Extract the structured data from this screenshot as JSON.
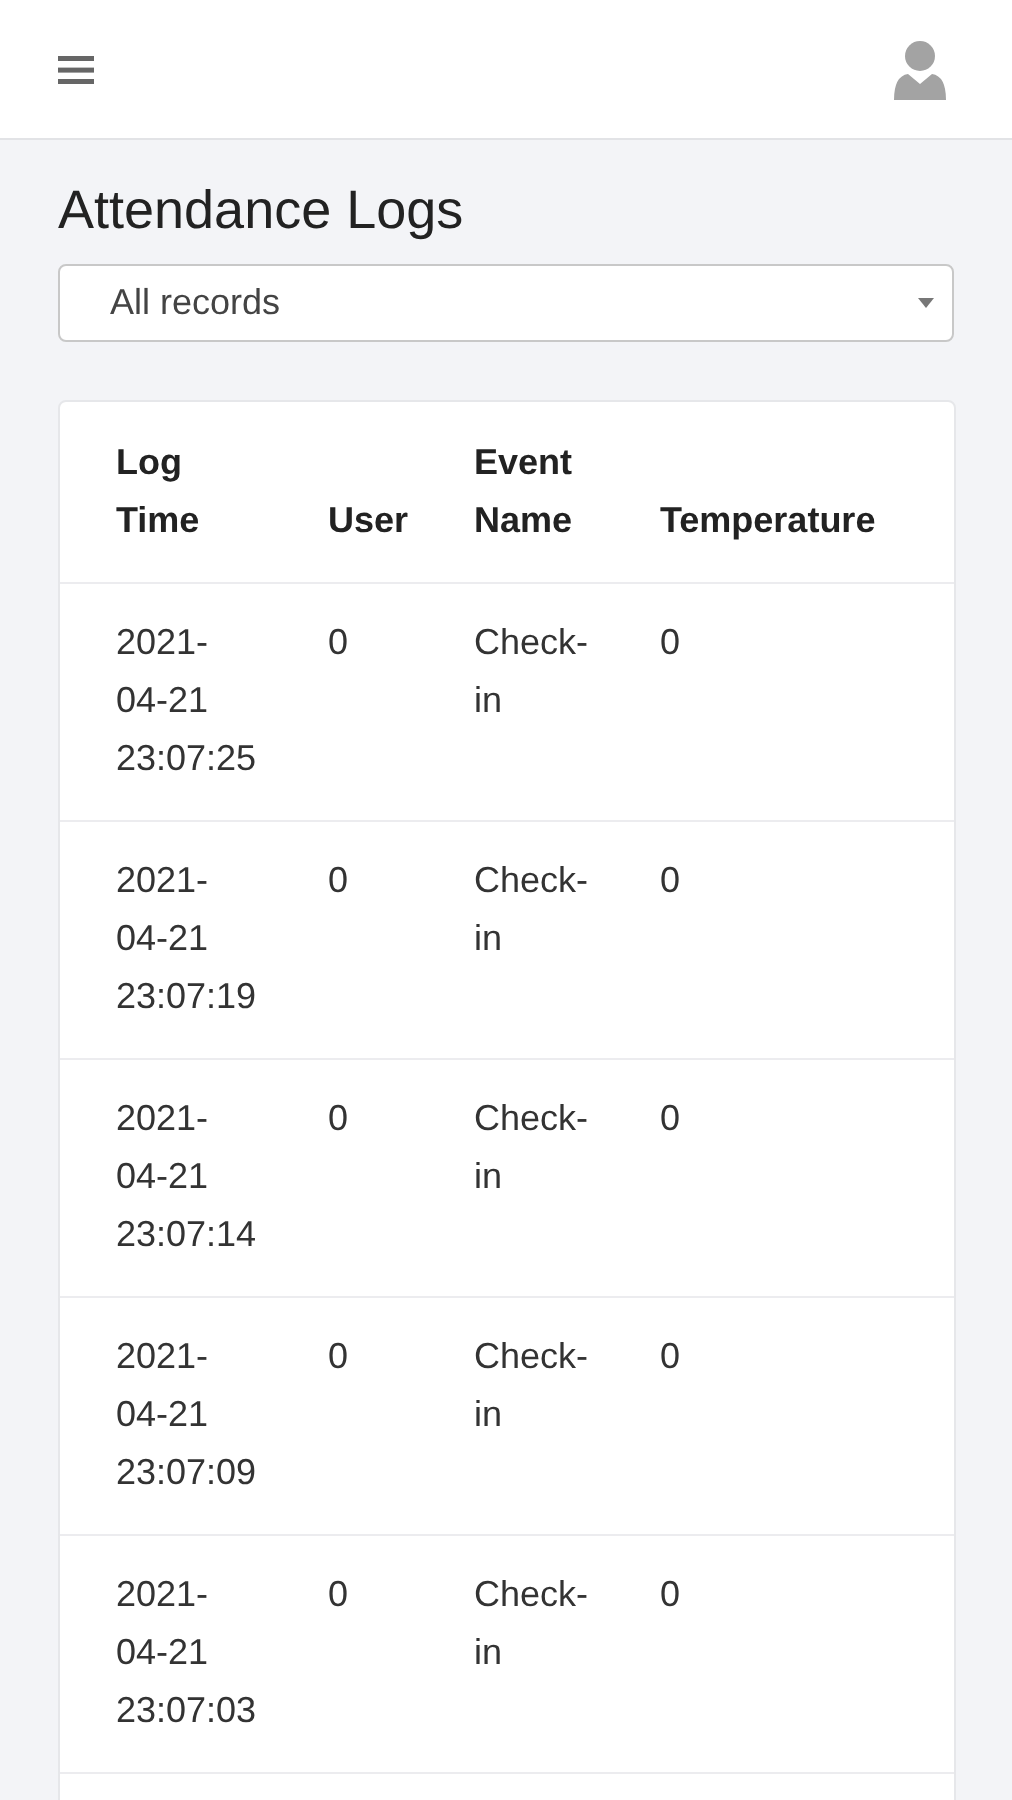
{
  "page": {
    "title": "Attendance Logs"
  },
  "filter": {
    "value": "All records"
  },
  "table": {
    "columns": [
      "Log Time",
      "User",
      "Event Name",
      "Temperature"
    ],
    "rows": [
      {
        "date": "2021-04-21",
        "time": "23:07:25",
        "user": "0",
        "event": "Check-in",
        "temperature": "0"
      },
      {
        "date": "2021-04-21",
        "time": "23:07:19",
        "user": "0",
        "event": "Check-in",
        "temperature": "0"
      },
      {
        "date": "2021-04-21",
        "time": "23:07:14",
        "user": "0",
        "event": "Check-in",
        "temperature": "0"
      },
      {
        "date": "2021-04-21",
        "time": "23:07:09",
        "user": "0",
        "event": "Check-in",
        "temperature": "0"
      },
      {
        "date": "2021-04-21",
        "time": "23:07:03",
        "user": "0",
        "event": "Check-in",
        "temperature": "0"
      }
    ]
  }
}
